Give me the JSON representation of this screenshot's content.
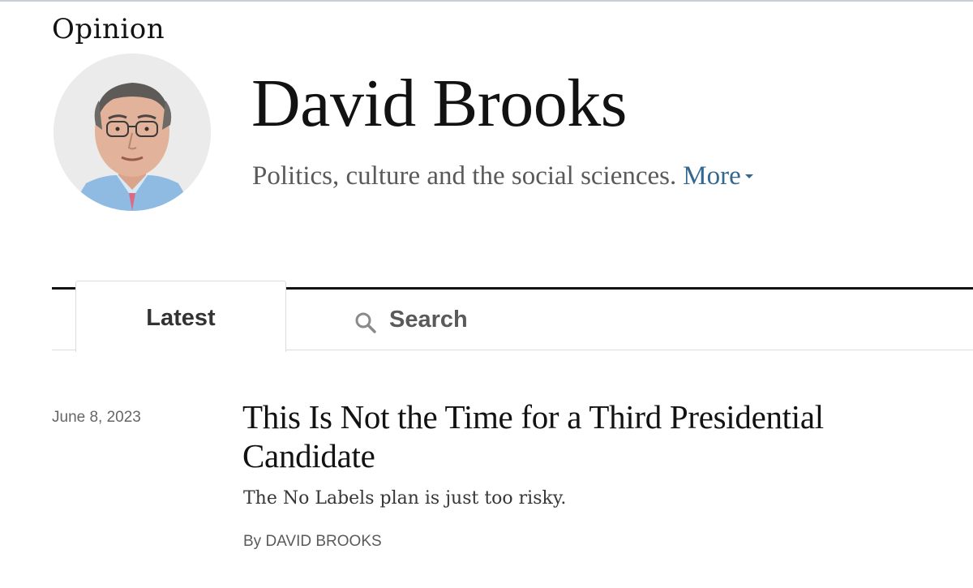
{
  "header": {
    "section_label": "Opinion",
    "author_name": "David Brooks",
    "author_bio": "Politics, culture and the social sciences.",
    "more_label": "More"
  },
  "tabs": [
    {
      "label": "Latest",
      "active": true
    },
    {
      "label": "Search",
      "icon": "search-icon",
      "active": false
    }
  ],
  "articles": [
    {
      "date": "June 8, 2023",
      "headline": "This Is Not the Time for a Third Presidential Candidate",
      "summary": "The No Labels plan is just too risky.",
      "byline": "By DAVID BROOKS"
    }
  ],
  "colors": {
    "link": "#326891",
    "text": "#121212",
    "muted": "#5a5a5a",
    "rule": "#121212",
    "divider": "#dcdcdc"
  }
}
